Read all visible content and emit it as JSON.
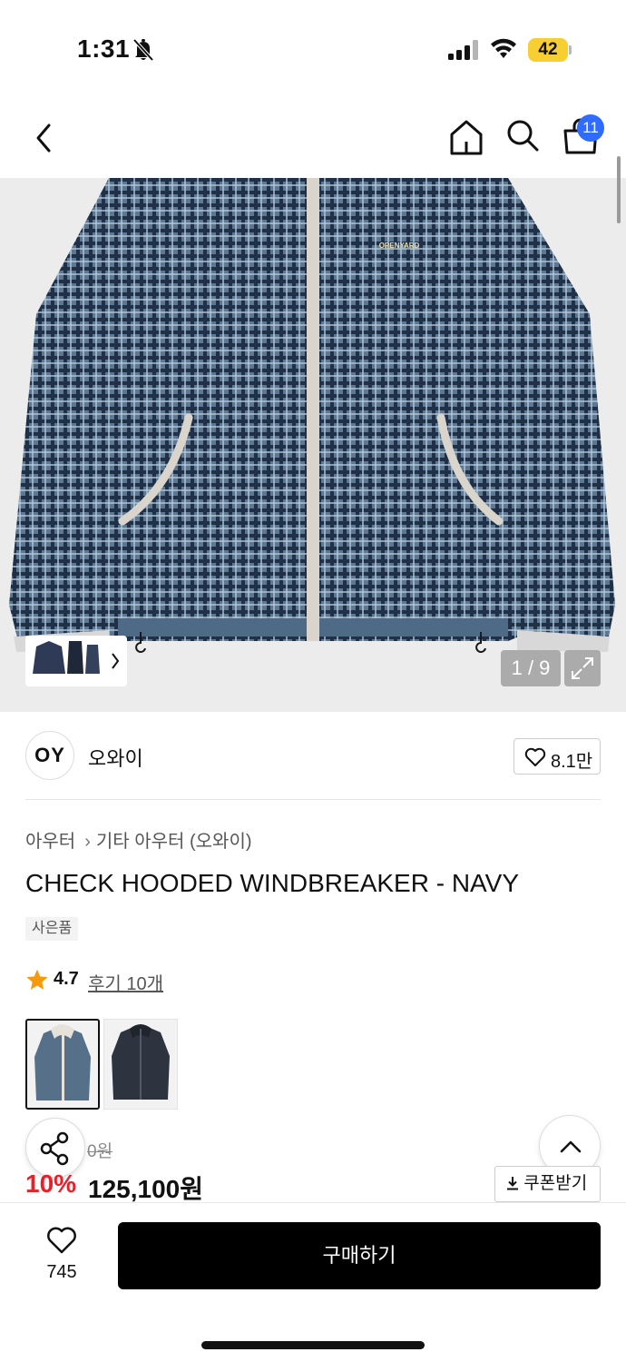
{
  "status_bar": {
    "time": "1:31",
    "battery": "42"
  },
  "nav": {
    "cart_count": "11"
  },
  "gallery": {
    "counter": "1 / 9",
    "jacket_print": "OPENYARD"
  },
  "brand": {
    "logo_text": "OY",
    "name": "오와이",
    "likes": "8.1만"
  },
  "product": {
    "breadcrumb": [
      "아우터",
      "기타 아우터 (오와이)"
    ],
    "title": "CHECK HOODED WINDBREAKER - NAVY",
    "gift_tag": "사은품",
    "rating": "4.7",
    "reviews": "후기 10개",
    "original_price": "0원",
    "discount": "10%",
    "sale_price": "125,100원",
    "coupon_label": "쿠폰받기"
  },
  "bottom_bar": {
    "wish_count": "745",
    "buy_label": "구매하기"
  },
  "colors": {
    "accent_badge": "#2f6bff",
    "discount_red": "#e8202a",
    "battery_yellow": "#f7cf32",
    "buy_button": "#000000",
    "star": "#f59a0b"
  }
}
